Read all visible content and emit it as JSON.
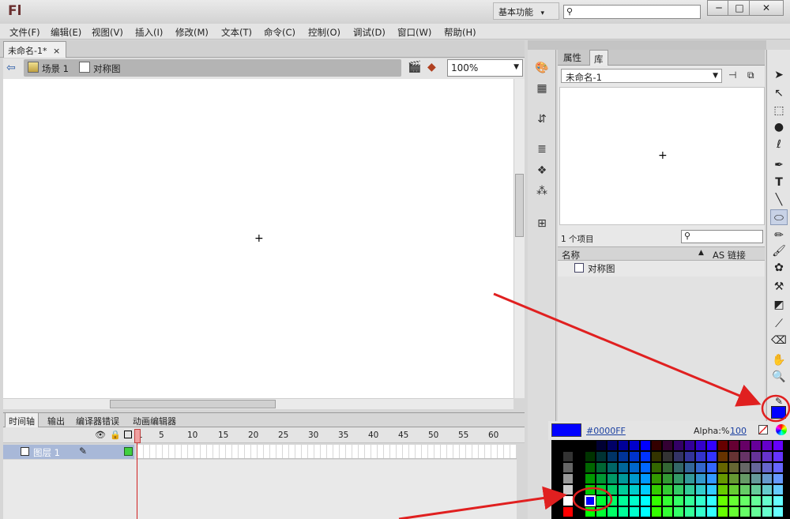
{
  "app": {
    "logo": "Fl",
    "workspace": "基本功能",
    "workspace_arrow": "▾"
  },
  "window_controls": {
    "minimize": "─",
    "maximize": "□",
    "close": "✕"
  },
  "menu": [
    "文件(F)",
    "编辑(E)",
    "视图(V)",
    "插入(I)",
    "修改(M)",
    "文本(T)",
    "命令(C)",
    "控制(O)",
    "调试(D)",
    "窗口(W)",
    "帮助(H)"
  ],
  "document": {
    "tab": "未命名-1*",
    "tab_close": "×",
    "scene": "场景 1",
    "symbol": "对称图",
    "zoom": "100%"
  },
  "stage": {
    "crosshair": "+"
  },
  "timeline": {
    "tabs": [
      "时间轴",
      "输出",
      "编译器错误",
      "动画编辑器"
    ],
    "frame_numbers": [
      "1",
      "5",
      "10",
      "15",
      "20",
      "25",
      "30",
      "35",
      "40",
      "45",
      "50",
      "55",
      "60"
    ],
    "layer_name": "图层 1"
  },
  "panel": {
    "tabs": [
      "属性",
      "库"
    ],
    "library_select": "未命名-1",
    "item_count": "1 个项目",
    "col_name": "名称",
    "col_linkage": "AS 链接",
    "item_name": "对称图",
    "crosshair": "+"
  },
  "swatches": {
    "hex": "#0000FF",
    "alpha_label": "Alpha:%",
    "alpha_value": "100",
    "selected_color": "#0000ff"
  },
  "colors": {
    "annotation_red": "#e02020",
    "stroke_color": "#0000ff"
  }
}
